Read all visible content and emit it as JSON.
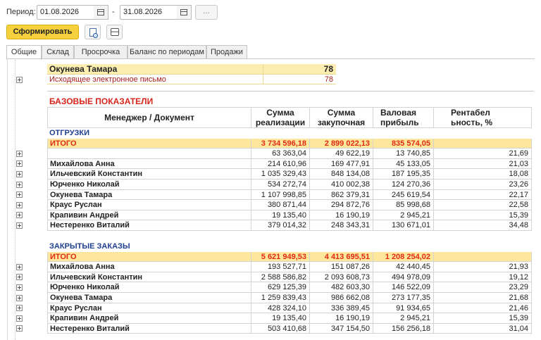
{
  "toolbar": {
    "period_label": "Период:",
    "date_from": "01.08.2026",
    "date_to": "31.08.2026",
    "dash": "-",
    "dots": "...",
    "generate_label": "Сформировать"
  },
  "tabs": [
    "Общие",
    "Склад",
    "Просрочка",
    "Баланс по периодам",
    "Продажи"
  ],
  "summary": {
    "manager": "Окунева Тамара",
    "manager_value": "78",
    "doc": "Исходящее электронное письмо",
    "doc_value": "78"
  },
  "report": {
    "title": "БАЗОВЫЕ ПОКАЗАТЕЛИ",
    "col_name": "Менеджер / Документ",
    "col_sale_1": "Сумма",
    "col_sale_2": "реализации",
    "col_buy_1": "Сумма",
    "col_buy_2": "закупочная",
    "col_profit_1": "Валовая",
    "col_profit_2": "прибыль",
    "col_rent_1": "Рентабел",
    "col_rent_2": "ьность, %"
  },
  "shipments": {
    "title": "ОТГРУЗКИ",
    "total_label": "ИТОГО",
    "total": [
      "3 734 596,18",
      "2 899 022,13",
      "835 574,05",
      ""
    ],
    "rows": [
      {
        "name": "",
        "v": [
          "63 363,04",
          "49 622,19",
          "13 740,85",
          "21,69"
        ]
      },
      {
        "name": "Михайлова Анна",
        "v": [
          "214 610,96",
          "169 477,91",
          "45 133,05",
          "21,03"
        ]
      },
      {
        "name": "Ильчевский Константин",
        "v": [
          "1 035 329,43",
          "848 134,08",
          "187 195,35",
          "18,08"
        ]
      },
      {
        "name": "Юрченко Николай",
        "v": [
          "534 272,74",
          "410 002,38",
          "124 270,36",
          "23,26"
        ]
      },
      {
        "name": "Окунева Тамара",
        "v": [
          "1 107 998,85",
          "862 379,31",
          "245 619,54",
          "22,17"
        ]
      },
      {
        "name": "Краус Руслан",
        "v": [
          "380 871,44",
          "294 872,76",
          "85 998,68",
          "22,58"
        ]
      },
      {
        "name": "Крапивин Андрей",
        "v": [
          "19 135,40",
          "16 190,19",
          "2 945,21",
          "15,39"
        ]
      },
      {
        "name": "Нестеренко Виталий",
        "v": [
          "379 014,32",
          "248 343,31",
          "130 671,01",
          "34,48"
        ]
      }
    ]
  },
  "closed_orders": {
    "title": "ЗАКРЫТЫЕ ЗАКАЗЫ",
    "total_label": "ИТОГО",
    "total": [
      "5 621 949,53",
      "4 413 695,51",
      "1 208 254,02",
      ""
    ],
    "rows": [
      {
        "name": "Михайлова Анна",
        "v": [
          "193 527,71",
          "151 087,26",
          "42 440,45",
          "21,93"
        ]
      },
      {
        "name": "Ильчевский Константин",
        "v": [
          "2 588 586,82",
          "2 093 608,73",
          "494 978,09",
          "19,12"
        ]
      },
      {
        "name": "Юрченко Николай",
        "v": [
          "629 125,39",
          "482 603,30",
          "146 522,09",
          "23,29"
        ]
      },
      {
        "name": "Окунева Тамара",
        "v": [
          "1 259 839,43",
          "986 662,08",
          "273 177,35",
          "21,68"
        ]
      },
      {
        "name": "Краус Руслан",
        "v": [
          "428 324,10",
          "336 389,45",
          "91 934,65",
          "21,46"
        ]
      },
      {
        "name": "Крапивин Андрей",
        "v": [
          "19 135,40",
          "16 190,19",
          "2 945,21",
          "15,39"
        ]
      },
      {
        "name": "Нестеренко Виталий",
        "v": [
          "503 410,68",
          "347 154,50",
          "156 256,18",
          "31,04"
        ]
      }
    ]
  },
  "colors": {
    "accent_yellow": "#f5d23d",
    "summary_bg": "#fbeeb0",
    "total_bg": "#fde79c",
    "total_text": "#e02a12",
    "section_blue": "#1f3f8f",
    "title_red": "#d6251a",
    "doc_red": "#a82020"
  }
}
